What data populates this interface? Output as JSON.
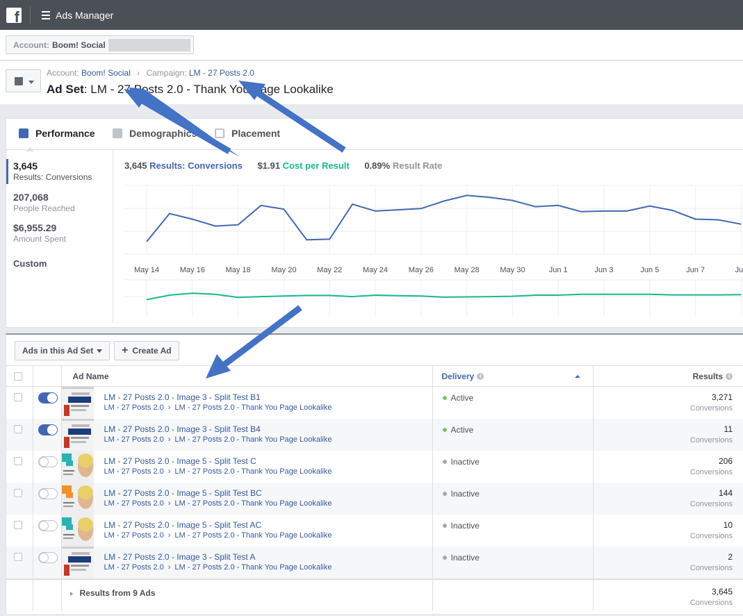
{
  "topbar": {
    "app_title": "Ads Manager",
    "logo_letter": "f"
  },
  "account": {
    "key": "Account:",
    "value": "Boom! Social"
  },
  "breadcrumb": {
    "account_key": "Account:",
    "account_value": "Boom! Social",
    "campaign_key": "Campaign:",
    "campaign_value": "LM - 27 Posts 2.0"
  },
  "adset": {
    "key": "Ad Set",
    "value": ": LM - 27 Posts 2.0 - Thank You Page Lookalike"
  },
  "tabs": [
    {
      "label": "Performance",
      "icon": "bar-chart-icon"
    },
    {
      "label": "Demographics",
      "icon": "people-icon"
    },
    {
      "label": "Placement",
      "icon": "placement-icon"
    }
  ],
  "metrics": [
    {
      "value": "3,645",
      "label": "Results: Conversions"
    },
    {
      "value": "207,068",
      "label": "People Reached"
    },
    {
      "value": "$6,955.29",
      "label": "Amount Spent"
    },
    {
      "value": "Custom",
      "label": ""
    }
  ],
  "summary": {
    "results_value": "3,645",
    "results_label": "Results: Conversions",
    "cost_value": "$1.91",
    "cost_label": "Cost per Result",
    "rate_value": "0.89%",
    "rate_label": "Result Rate"
  },
  "colors": {
    "results": "#4267b2",
    "cost": "#17b890",
    "active": "#7cc360",
    "inactive": "#a3a8b0"
  },
  "chart_data": {
    "type": "line",
    "x": [
      "May 14",
      "May 15",
      "May 16",
      "May 17",
      "May 18",
      "May 19",
      "May 20",
      "May 21",
      "May 22",
      "May 23",
      "May 24",
      "May 25",
      "May 26",
      "May 27",
      "May 28",
      "May 29",
      "May 30",
      "May 31",
      "Jun 1",
      "Jun 2",
      "Jun 3",
      "Jun 4",
      "Jun 5",
      "Jun 6",
      "Jun 7",
      "Jun 8",
      "Jun 9"
    ],
    "tick_labels": [
      "May 14",
      "May 16",
      "May 18",
      "May 20",
      "May 22",
      "May 24",
      "May 26",
      "May 28",
      "May 30",
      "Jun 1",
      "Jun 3",
      "Jun 5",
      "Jun 7",
      "Jun"
    ],
    "series": [
      {
        "values": [
          60,
          105,
          96,
          85,
          87,
          118,
          112,
          63,
          64,
          120,
          109,
          111,
          113,
          125,
          134,
          131,
          126,
          116,
          118,
          108,
          109,
          109,
          117,
          110,
          96,
          95,
          88
        ],
        "ylim": [
          40,
          150
        ]
      },
      {
        "values": [
          60,
          76,
          83,
          79,
          68,
          71,
          73,
          75,
          75,
          71,
          76,
          74,
          73,
          69,
          70,
          71,
          72,
          76,
          76,
          79,
          79,
          79,
          79,
          77,
          77,
          77,
          78
        ],
        "ylim": [
          0,
          130
        ]
      }
    ],
    "grid": true
  },
  "ads_toolbar": {
    "filter_label": "Ads in this Ad Set",
    "create_label": "Create Ad"
  },
  "columns": {
    "name": "Ad Name",
    "delivery": "Delivery",
    "results": "Results"
  },
  "ads": [
    {
      "name": "LM - 27 Posts 2.0 - Image 3 - Split Test B1",
      "campaign": "LM - 27 Posts 2.0",
      "adset": "LM - 27 Posts 2.0 - Thank You Page Lookalike",
      "on": true,
      "delivery": "Active",
      "results": "3,271",
      "unit": "Conversions",
      "thumb": "facebook"
    },
    {
      "name": "LM - 27 Posts 2.0 - Image 3 - Split Test B4",
      "campaign": "LM - 27 Posts 2.0",
      "adset": "LM - 27 Posts 2.0 - Thank You Page Lookalike",
      "on": true,
      "delivery": "Active",
      "results": "11",
      "unit": "Conversions",
      "thumb": "facebook"
    },
    {
      "name": "LM - 27 Posts 2.0 - Image 5 - Split Test C",
      "campaign": "LM - 27 Posts 2.0",
      "adset": "LM - 27 Posts 2.0 - Thank You Page Lookalike",
      "on": false,
      "delivery": "Inactive",
      "results": "206",
      "unit": "Conversions",
      "thumb": "portrait-teal"
    },
    {
      "name": "LM - 27 Posts 2.0 - Image 5 - Split Test BC",
      "campaign": "LM - 27 Posts 2.0",
      "adset": "LM - 27 Posts 2.0 - Thank You Page Lookalike",
      "on": false,
      "delivery": "Inactive",
      "results": "144",
      "unit": "Conversions",
      "thumb": "portrait-orange"
    },
    {
      "name": "LM - 27 Posts 2.0 - Image 5 - Split Test AC",
      "campaign": "LM - 27 Posts 2.0",
      "adset": "LM - 27 Posts 2.0 - Thank You Page Lookalike",
      "on": false,
      "delivery": "Inactive",
      "results": "10",
      "unit": "Conversions",
      "thumb": "portrait-teal"
    },
    {
      "name": "LM - 27 Posts 2.0 - Image 3 - Split Test A",
      "campaign": "LM - 27 Posts 2.0",
      "adset": "LM - 27 Posts 2.0 - Thank You Page Lookalike",
      "on": false,
      "delivery": "Inactive",
      "results": "2",
      "unit": "Conversions",
      "thumb": "facebook"
    }
  ],
  "footer": {
    "label": "Results from 9 Ads",
    "results": "3,645",
    "unit": "Conversions"
  }
}
